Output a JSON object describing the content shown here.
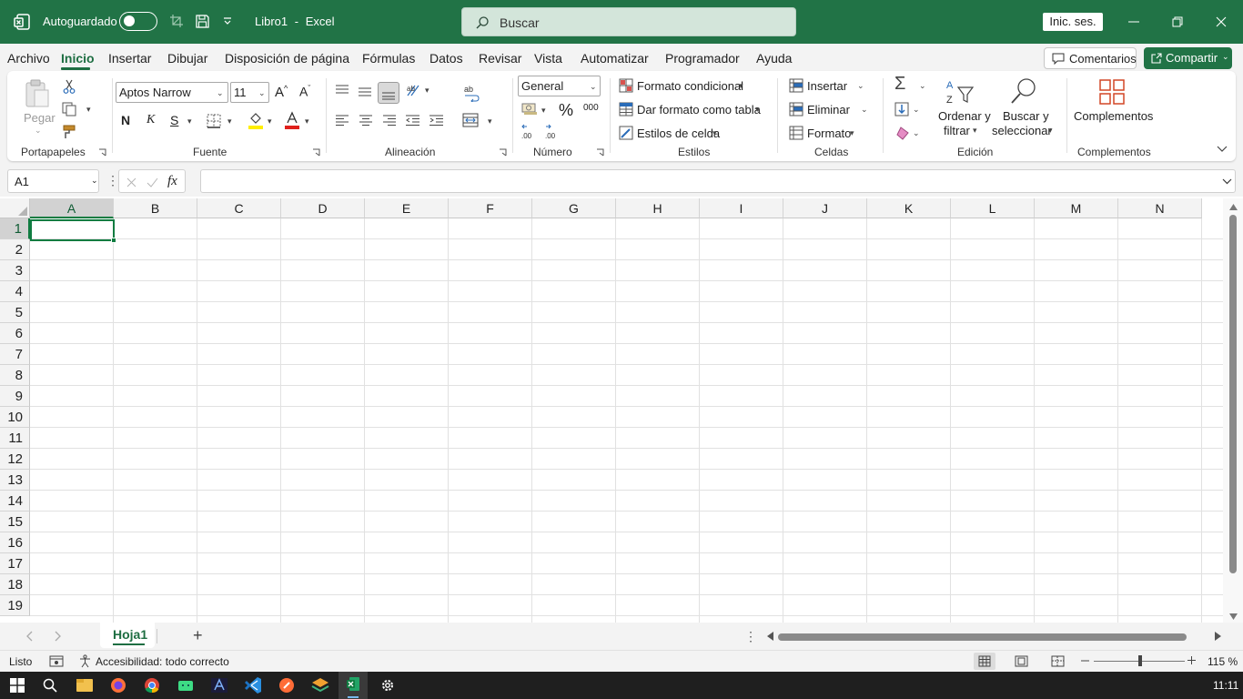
{
  "titlebar": {
    "autosave_label": "Autoguardado",
    "doc_name": "Libro1",
    "separator": "-",
    "app_name": "Excel",
    "search_placeholder": "Buscar",
    "signin_label": "Inic. ses."
  },
  "menu": {
    "tabs": [
      "Archivo",
      "Inicio",
      "Insertar",
      "Dibujar",
      "Disposición de página",
      "Fórmulas",
      "Datos",
      "Revisar",
      "Vista",
      "Automatizar",
      "Programador",
      "Ayuda"
    ],
    "active_tab": "Inicio",
    "comments_label": "Comentarios",
    "share_label": "Compartir"
  },
  "ribbon": {
    "clipboard": {
      "paste_label": "Pegar",
      "group_label": "Portapapeles"
    },
    "font": {
      "font_name": "Aptos Narrow",
      "font_size": "11",
      "bold": "N",
      "italic": "K",
      "underline": "S",
      "group_label": "Fuente"
    },
    "alignment": {
      "group_label": "Alineación"
    },
    "number": {
      "format": "General",
      "percent": "%",
      "thousands": "000",
      "group_label": "Número"
    },
    "styles": {
      "conditional": "Formato condicional",
      "as_table": "Dar formato como tabla",
      "cell_styles": "Estilos de celda",
      "group_label": "Estilos"
    },
    "cells": {
      "insert": "Insertar",
      "delete": "Eliminar",
      "format": "Formato",
      "group_label": "Celdas"
    },
    "editing": {
      "sort_line1": "Ordenar y",
      "sort_line2": "filtrar",
      "find_line1": "Buscar y",
      "find_line2": "seleccionar",
      "group_label": "Edición"
    },
    "addins": {
      "label": "Complementos",
      "group_label": "Complementos"
    }
  },
  "formula": {
    "name_box": "A1",
    "fx": "fx",
    "value": ""
  },
  "sheet": {
    "columns": [
      "A",
      "B",
      "C",
      "D",
      "E",
      "F",
      "G",
      "H",
      "I",
      "J",
      "K",
      "L",
      "M",
      "N"
    ],
    "rows": [
      "1",
      "2",
      "3",
      "4",
      "5",
      "6",
      "7",
      "8",
      "9",
      "10",
      "11",
      "12",
      "13",
      "14",
      "15",
      "16",
      "17",
      "18",
      "19"
    ],
    "active_cell": "A1"
  },
  "sheettabs": {
    "tabs": [
      "Hoja1"
    ],
    "add": "+"
  },
  "status": {
    "ready": "Listo",
    "accessibility": "Accesibilidad: todo correcto",
    "zoom": "115 %"
  },
  "taskbar": {
    "clock": "11:11"
  },
  "colors": {
    "brand": "#217346",
    "selection": "#107c41",
    "header_active": "#d2d2d2"
  }
}
